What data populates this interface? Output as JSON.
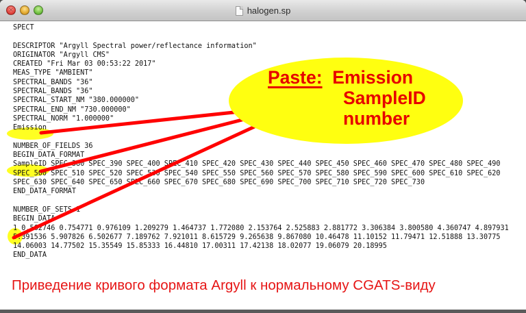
{
  "window": {
    "title": "halogen.sp"
  },
  "file": {
    "lines": [
      "SPECT",
      "",
      "DESCRIPTOR \"Argyll Spectral power/reflectance information\"",
      "ORIGINATOR \"Argyll CMS\"",
      "CREATED \"Fri Mar 03 00:53:22 2017\"",
      "MEAS_TYPE \"AMBIENT\"",
      "SPECTRAL_BANDS \"36\"",
      "SPECTRAL_BANDS \"36\"",
      "SPECTRAL_START_NM \"380.000000\"",
      "SPECTRAL_END_NM \"730.000000\"",
      "SPECTRAL_NORM \"1.000000\"",
      "Emission",
      "",
      "NUMBER_OF_FIELDS 36",
      "BEGIN_DATA_FORMAT",
      "SampleID SPEC_380 SPEC_390 SPEC_400 SPEC_410 SPEC_420 SPEC_430 SPEC_440 SPEC_450 SPEC_460 SPEC_470 SPEC_480 SPEC_490",
      "SPEC_500 SPEC_510 SPEC_520 SPEC_530 SPEC_540 SPEC_550 SPEC_560 SPEC_570 SPEC_580 SPEC_590 SPEC_600 SPEC_610 SPEC_620",
      "SPEC_630 SPEC_640 SPEC_650 SPEC_660 SPEC_670 SPEC_680 SPEC_690 SPEC_700 SPEC_710 SPEC_720 SPEC_730",
      "END_DATA_FORMAT",
      "",
      "NUMBER_OF_SETS 1",
      "BEGIN_DATA",
      "1 0.562746 0.754771 0.976109 1.209279 1.464737 1.772080 2.153764 2.525883 2.881772 3.306384 3.800580 4.360747 4.897931",
      "5.391536 5.907826 6.502677 7.189762 7.921011 8.615729 9.265638 9.867080 10.46478 11.10152 11.79471 12.51888 13.30775",
      "14.06003 14.77502 15.35549 15.85333 16.44810 17.00311 17.42138 18.02077 19.06079 20.18995",
      "END_DATA"
    ]
  },
  "annotation": {
    "paste_label": "Paste:",
    "line1_rest": "Emission",
    "line2": "SampleID",
    "line3": "number",
    "caption": "Приведение кривого формата Argyll к нормальному CGATS-виду"
  },
  "colors": {
    "highlight": "#ffff22",
    "annotation_red": "#e60000"
  }
}
